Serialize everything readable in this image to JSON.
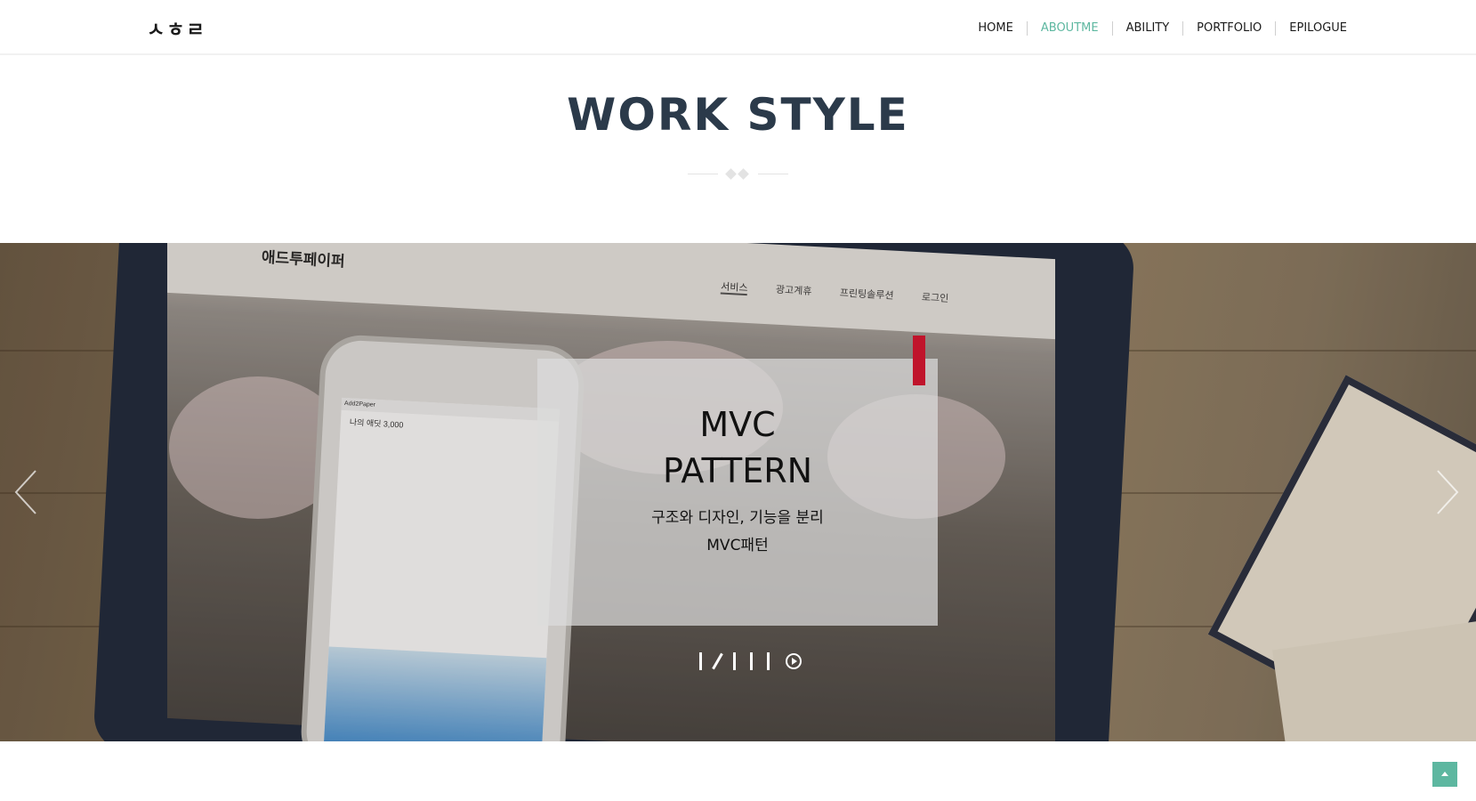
{
  "header": {
    "logo": "ㅅㅎㄹ",
    "nav": [
      {
        "label": "HOME",
        "active": false
      },
      {
        "label": "ABOUTME",
        "active": true
      },
      {
        "label": "ABILITY",
        "active": false
      },
      {
        "label": "PORTFOLIO",
        "active": false
      },
      {
        "label": "EPILOGUE",
        "active": false
      }
    ]
  },
  "section": {
    "title": "WORK STYLE"
  },
  "slider": {
    "background_site": {
      "logo": "애드투페이퍼",
      "menu": [
        "서비스",
        "광고계휴",
        "프린팅솔루션",
        "로그인"
      ],
      "phone_status": "Add2Paper",
      "phone_text": "나의 애딧 3,000"
    },
    "caption": {
      "title": "MVC PATTERN",
      "description_line1": "구조와 디자인, 기능을 분리",
      "description_line2": "MVC패턴"
    },
    "pagination": {
      "count": 5,
      "active_index": 1,
      "play_icon": "play-circle-icon"
    },
    "colors": {
      "accent": "#c0142b",
      "brand": "#5db7a0"
    }
  },
  "scroll_top": {
    "icon": "chevron-up-icon"
  }
}
